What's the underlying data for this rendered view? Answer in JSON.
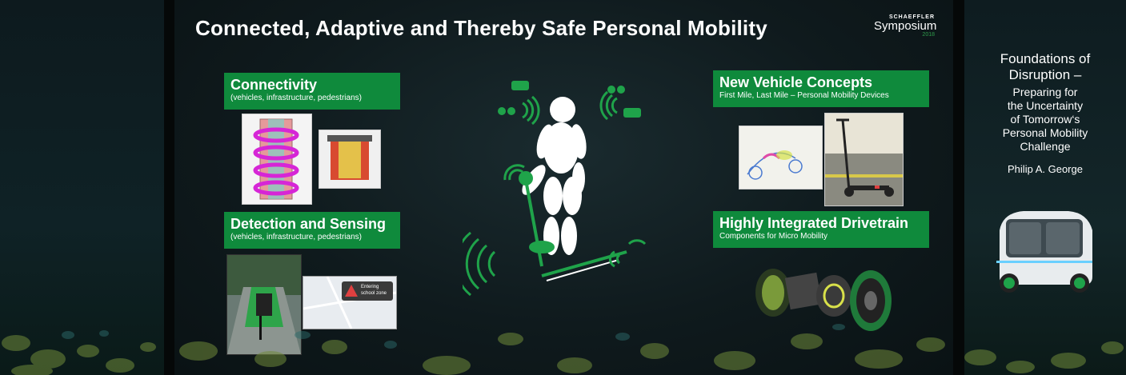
{
  "slide": {
    "title": "Connected, Adaptive and Thereby Safe Personal Mobility",
    "brand": {
      "top": "SCHAEFFLER",
      "name": "Symposium",
      "year": "2018"
    },
    "boxes": {
      "connectivity": {
        "heading": "Connectivity",
        "sub": "(vehicles, infrastructure, pedestrians)"
      },
      "detection": {
        "heading": "Detection and Sensing",
        "sub": "(vehicles, infrastructure, pedestrians)"
      },
      "vehicle_concepts": {
        "heading": "New Vehicle Concepts",
        "sub": "First Mile, Last Mile – Personal Mobility Devices"
      },
      "drivetrain": {
        "heading": "Highly Integrated Drivetrain",
        "sub": "Components for Micro Mobility"
      }
    },
    "map_label": "Entering school zone"
  },
  "sidebar": {
    "line1": "Foundations of",
    "line2": "Disruption –",
    "line3": "Preparing for",
    "line4": "the Uncertainty",
    "line5": "of Tomorrow‘s",
    "line6": "Personal Mobility",
    "line7": "Challenge",
    "author": "Philip A. George"
  },
  "colors": {
    "accent": "#0f8a3c",
    "background": "#0f1a1d",
    "icon_green": "#1fa34a"
  }
}
